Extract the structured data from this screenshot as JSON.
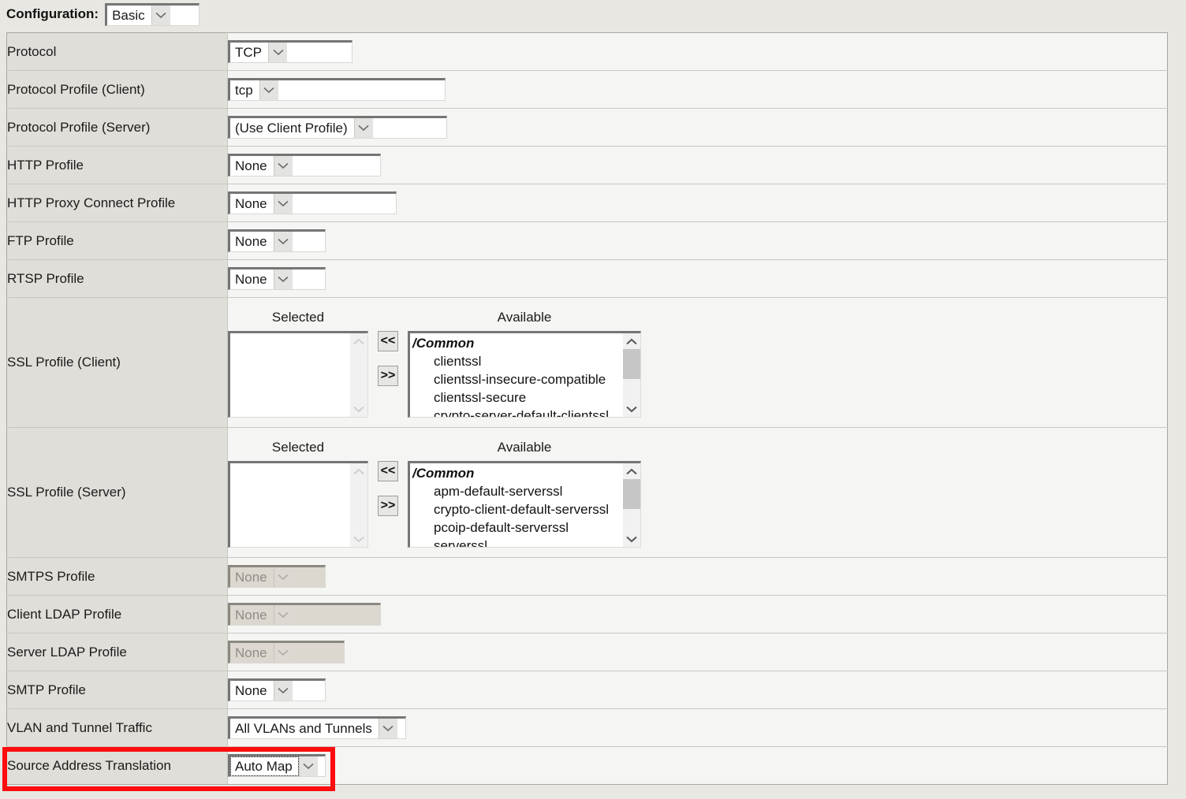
{
  "config_bar": {
    "label": "Configuration:",
    "value": "Basic"
  },
  "table": {
    "rows": [
      {
        "label": "Protocol",
        "value": "TCP",
        "widget": "select",
        "state": "enabled"
      },
      {
        "label": "Protocol Profile (Client)",
        "value": "tcp",
        "widget": "select",
        "state": "enabled"
      },
      {
        "label": "Protocol Profile (Server)",
        "value": "(Use Client Profile)",
        "widget": "select",
        "state": "enabled"
      },
      {
        "label": "HTTP Profile",
        "value": "None",
        "widget": "select",
        "state": "enabled"
      },
      {
        "label": "HTTP Proxy Connect Profile",
        "value": "None",
        "widget": "select",
        "state": "enabled"
      },
      {
        "label": "FTP Profile",
        "value": "None",
        "widget": "select",
        "state": "enabled"
      },
      {
        "label": "RTSP Profile",
        "value": "None",
        "widget": "select",
        "state": "enabled"
      },
      {
        "label": "SSL Profile (Client)",
        "widget": "duallist"
      },
      {
        "label": "SSL Profile (Server)",
        "widget": "duallist"
      },
      {
        "label": "SMTPS Profile",
        "value": "None",
        "widget": "select",
        "state": "disabled"
      },
      {
        "label": "Client LDAP Profile",
        "value": "None",
        "widget": "select",
        "state": "disabled"
      },
      {
        "label": "Server LDAP Profile",
        "value": "None",
        "widget": "select",
        "state": "disabled"
      },
      {
        "label": "SMTP Profile",
        "value": "None",
        "widget": "select",
        "state": "enabled"
      },
      {
        "label": "VLAN and Tunnel Traffic",
        "value": "All VLANs and Tunnels",
        "widget": "select",
        "state": "enabled"
      },
      {
        "label": "Source Address Translation",
        "value": "Auto Map",
        "widget": "select",
        "state": "focused"
      }
    ]
  },
  "duallists": {
    "headers": {
      "selected": "Selected",
      "available": "Available"
    },
    "buttons": {
      "move_left": "<<",
      "move_right": ">>"
    },
    "ssl_client": {
      "selected": [],
      "available": [
        "/Common",
        "clientssl",
        "clientssl-insecure-compatible",
        "clientssl-secure",
        "crypto-server-default-clientssl"
      ]
    },
    "ssl_server": {
      "selected": [],
      "available": [
        "/Common",
        "apm-default-serverssl",
        "crypto-client-default-serverssl",
        "pcoip-default-serverssl",
        "serverssl"
      ]
    }
  },
  "annotation": {
    "highlight_color": "#fc0d0d",
    "highlighted_row": "Source Address Translation"
  },
  "colors": {
    "page_background": "#e8e7e2",
    "label_column": "#e0ded9",
    "value_column": "#f5f5f3",
    "select_border": "#757575",
    "disabled_select_background": "#dcd8d0"
  }
}
